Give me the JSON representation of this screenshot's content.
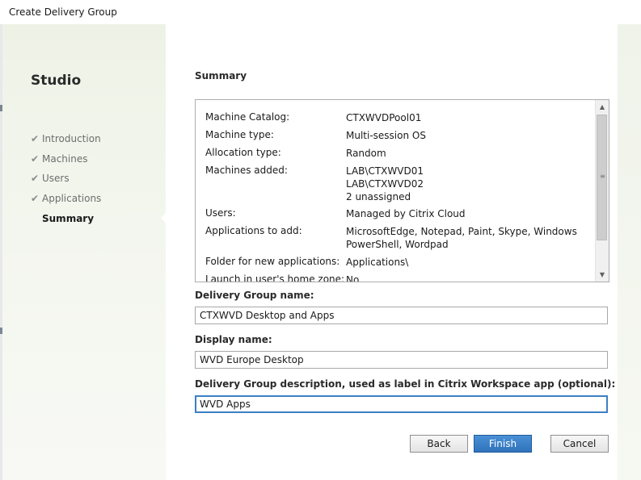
{
  "window": {
    "title": "Create Delivery Group"
  },
  "sidebar": {
    "app_title": "Studio",
    "items": [
      {
        "label": "Introduction",
        "completed": true,
        "active": false
      },
      {
        "label": "Machines",
        "completed": true,
        "active": false
      },
      {
        "label": "Users",
        "completed": true,
        "active": false
      },
      {
        "label": "Applications",
        "completed": true,
        "active": false
      },
      {
        "label": "Summary",
        "completed": false,
        "active": true
      }
    ],
    "check_icon": "checkmark-icon"
  },
  "main": {
    "heading": "Summary",
    "summary": {
      "rows": [
        {
          "label": "Machine Catalog:",
          "value": "CTXWVDPool01"
        },
        {
          "label": "Machine type:",
          "value": "Multi-session OS"
        },
        {
          "label": "Allocation type:",
          "value": "Random"
        },
        {
          "label": "Machines added:",
          "value_lines": [
            "LAB\\CTXWVD01",
            "LAB\\CTXWVD02",
            "2 unassigned"
          ]
        },
        {
          "label": "Users:",
          "value": "Managed by Citrix Cloud"
        },
        {
          "label": "Applications to add:",
          "value_lines": [
            "MicrosoftEdge, Notepad, Paint, Skype, Windows",
            "PowerShell, Wordpad"
          ]
        },
        {
          "label": "Folder for new applications:",
          "value": "Applications\\"
        },
        {
          "label": "Launch in user's home zone:",
          "value": "No"
        }
      ]
    },
    "fields": {
      "group_name": {
        "label": "Delivery Group name:",
        "value": "CTXWVD Desktop and Apps"
      },
      "display_name": {
        "label": "Display name:",
        "value": "WVD Europe Desktop"
      },
      "description": {
        "label": "Delivery Group description, used as label in Citrix Workspace app (optional):",
        "value": "WVD Apps"
      }
    },
    "buttons": {
      "back": "Back",
      "finish": "Finish",
      "cancel": "Cancel"
    }
  },
  "colors": {
    "sidebar_bg": "#eef2e6",
    "accent_blue": "#2f73bb",
    "focus_border": "#3b7fc4"
  }
}
